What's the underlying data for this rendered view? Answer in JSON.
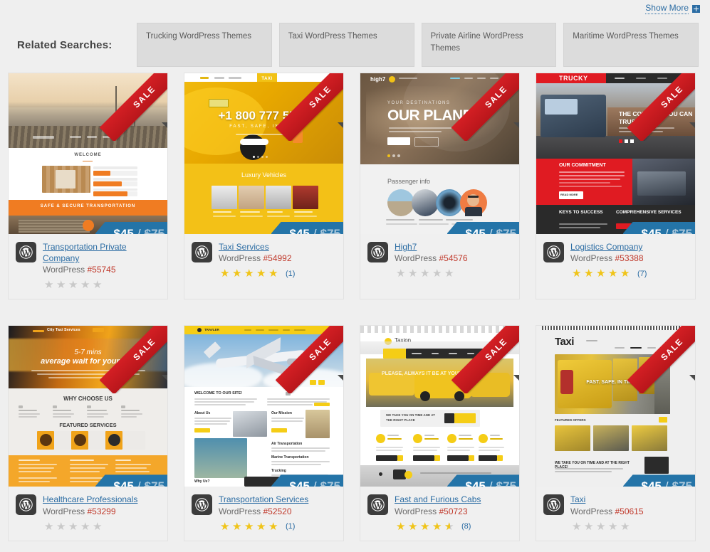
{
  "header": {
    "show_more_label": "Show More",
    "show_more_icon": "plus-square-icon"
  },
  "related": {
    "label": "Related Searches:",
    "chips": [
      "Trucking WordPress Themes",
      "Taxi WordPress Themes",
      "Private Airline WordPress Themes",
      "Maritime WordPress Themes"
    ]
  },
  "badges": {
    "sale_label": "SALE",
    "price_now": "$45",
    "price_separator": "/",
    "price_old": "$75"
  },
  "colors": {
    "page_bg": "#efefef",
    "card_bg": "#f0f0f0",
    "sale_red": "#cf1f21",
    "price_blue": "#2474a8",
    "link_blue": "#2b6ca3",
    "sku_red": "#c0392b",
    "star_gold": "#f0c419",
    "star_grey": "#c9c9c9"
  },
  "products": [
    {
      "title": "Transportation Private Company",
      "platform": "WordPress",
      "sku": "#55745",
      "price_now": "$45",
      "price_old": "$75",
      "sale_label": "SALE",
      "rating": 0,
      "review_count": "",
      "icon": "wordpress-icon"
    },
    {
      "title": "Taxi Services",
      "platform": "WordPress",
      "sku": "#54992",
      "price_now": "$45",
      "price_old": "$75",
      "sale_label": "SALE",
      "rating": 5,
      "review_count": "(1)",
      "icon": "wordpress-icon"
    },
    {
      "title": "High7",
      "platform": "WordPress",
      "sku": "#54576",
      "price_now": "$45",
      "price_old": "$75",
      "sale_label": "SALE",
      "rating": 0,
      "review_count": "",
      "icon": "wordpress-icon"
    },
    {
      "title": "Logistics Company",
      "platform": "WordPress",
      "sku": "#53388",
      "price_now": "$45",
      "price_old": "$75",
      "sale_label": "SALE",
      "rating": 5,
      "review_count": "(7)",
      "icon": "wordpress-icon"
    },
    {
      "title": "Healthcare Professionals",
      "platform": "WordPress",
      "sku": "#53299",
      "price_now": "$45",
      "price_old": "$75",
      "sale_label": "SALE",
      "rating": 0,
      "review_count": "",
      "icon": "wordpress-icon"
    },
    {
      "title": "Transportation Services",
      "platform": "WordPress",
      "sku": "#52520",
      "price_now": "$45",
      "price_old": "$75",
      "sale_label": "SALE",
      "rating": 5,
      "review_count": "(1)",
      "icon": "wordpress-icon"
    },
    {
      "title": "Fast and Furious Cabs",
      "platform": "WordPress",
      "sku": "#50723",
      "price_now": "$45",
      "price_old": "$75",
      "sale_label": "SALE",
      "rating": 4.5,
      "review_count": "(8)",
      "icon": "wordpress-icon"
    },
    {
      "title": "Taxi",
      "platform": "WordPress",
      "sku": "#50615",
      "price_now": "$45",
      "price_old": "$75",
      "sale_label": "SALE",
      "rating": 0,
      "review_count": "",
      "icon": "wordpress-icon"
    }
  ],
  "thumbnail_text": {
    "p0": {
      "welcome": "WELCOME",
      "banner": "SAFE & SECURE TRANSPORTATION"
    },
    "p1": {
      "phone": "+1 800 777 5555",
      "tagline": "FAST, SAFE, IN TIME",
      "section": "Luxury Vehicles",
      "logo": "TAXI"
    },
    "p2": {
      "eyebrow": "YOUR DESTINATIONS",
      "headline": "OUR PLANES",
      "section": "Passenger info",
      "logo": "high7"
    },
    "p3": {
      "logo": "TRUCKY",
      "headline": "THE COMPANY YOU CAN TRUST",
      "block1": "OUR COMMITMENT",
      "btn": "READ MORE",
      "foot1": "KEYS TO SUCCESS",
      "foot2": "COMPREHENSIVE SERVICES"
    },
    "p4": {
      "logo": "City Taxi Services",
      "headline1": "5-7 mins",
      "headline2": "average wait for your taxi",
      "section1": "WHY CHOOSE US",
      "section2": "FEATURED SERVICES"
    },
    "p5": {
      "logo": "TRAVLER",
      "section1": "WELCOME TO OUR SITE!",
      "b1": "About Us",
      "b2": "Our Mission",
      "b3": "Air Transportation",
      "b4": "Marine Transportation",
      "b5": "Trucking",
      "b6": "Why Us?"
    },
    "p6": {
      "logo": "Taxion",
      "headline": "PLEASE, ALWAYS IT BE AT YOUR SERVICE",
      "strip": "WE TAKE YOU ON TIME AND AT THE RIGHT PLACE"
    },
    "p7": {
      "logo": "Taxi",
      "headline": "FAST. SAFE. IN TIME.",
      "section": "FEATURED OFFERS",
      "strip": "WE TAKE YOU ON TIME AND AT THE RIGHT PLACE!"
    }
  }
}
